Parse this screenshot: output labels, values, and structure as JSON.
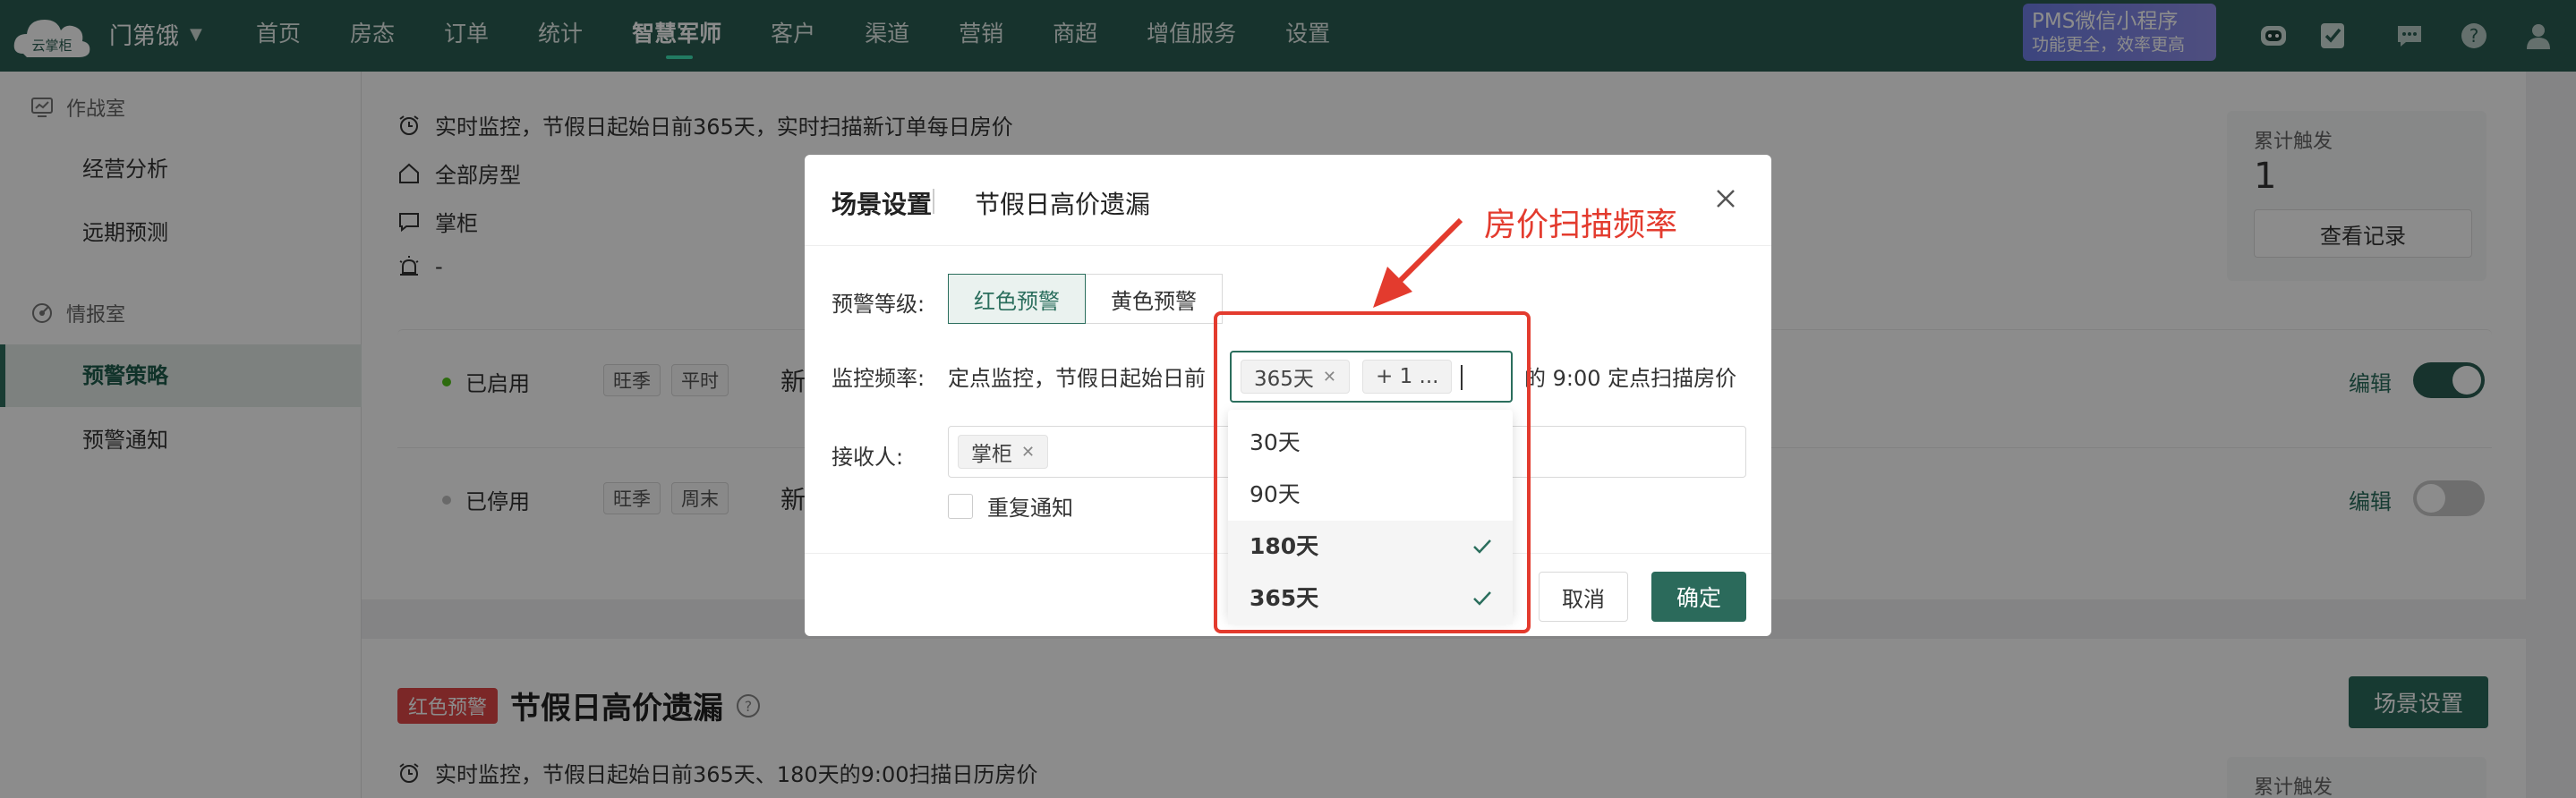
{
  "nav": {
    "logo_text": "云掌柜",
    "store_name": "门第饿",
    "items": [
      "首页",
      "房态",
      "订单",
      "统计",
      "智慧军师",
      "客户",
      "渠道",
      "营销",
      "商超",
      "增值服务",
      "设置"
    ],
    "active": "智慧军师",
    "pms_title": "PMS微信小程序",
    "pms_sub": "功能更全，效率更高"
  },
  "sidebar": {
    "group1": "作战室",
    "group1_items": [
      "经营分析",
      "远期预测"
    ],
    "group2": "情报室",
    "group2_items": [
      "预警策略",
      "预警通知"
    ],
    "active": "预警策略"
  },
  "card1": {
    "lines": [
      "实时监控，节假日起始日前365天，实时扫描新订单每日房价",
      "全部房型",
      "掌柜",
      "-"
    ],
    "stat_label": "累计触发",
    "stat_value": "1",
    "stat_button": "查看记录",
    "rows": [
      {
        "status": "已启用",
        "tags": [
          "旺季",
          "平时"
        ],
        "title": "新订单",
        "edit": "编辑",
        "enabled": true,
        "status_color": "#52c41a"
      },
      {
        "status": "已停用",
        "tags": [
          "旺季",
          "周末"
        ],
        "title": "新订单",
        "edit": "编辑",
        "enabled": false,
        "status_color": "#bfbfbf"
      }
    ]
  },
  "card2": {
    "badge": "红色预警",
    "title": "节假日高价遗漏",
    "button": "场景设置",
    "line": "实时监控，节假日起始日前365天、180天的9:00扫描日历房价",
    "stat_label": "累计触发"
  },
  "modal": {
    "title": "场景设置",
    "subtitle": "节假日高价遗漏",
    "level_label": "预警等级:",
    "levels": [
      "红色预警",
      "黄色预警"
    ],
    "level_selected": "红色预警",
    "freq_label": "监控频率:",
    "freq_prefix": "定点监控，节假日起始日前",
    "freq_suffix": "的 9:00 定点扫描房价",
    "select_chips": [
      "365天",
      "+ 1 ..."
    ],
    "receiver_label": "接收人:",
    "receiver_chip": "掌柜",
    "repeat_label": "重复通知",
    "cancel": "取消",
    "ok": "确定"
  },
  "dropdown": {
    "options": [
      {
        "label": "30天",
        "selected": false
      },
      {
        "label": "90天",
        "selected": false
      },
      {
        "label": "180天",
        "selected": true
      },
      {
        "label": "365天",
        "selected": true
      }
    ]
  },
  "annotation": {
    "text": "房价扫描频率",
    "color": "#e33b2e"
  },
  "colors": {
    "brand": "#2b5d52",
    "accent": "#2b6e5d",
    "danger": "#e04848"
  }
}
